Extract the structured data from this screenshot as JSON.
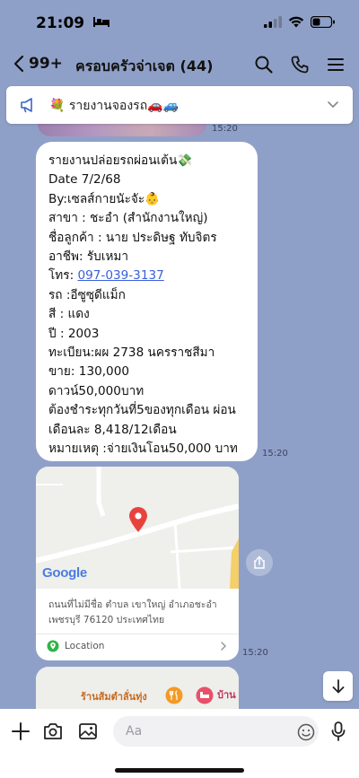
{
  "status_bar": {
    "time": "21:09"
  },
  "header": {
    "back_count": "99+",
    "title": "ครอบครัวจ่าเจต (44)"
  },
  "pinned": {
    "text": "💐 รายงานจองรถ🚗🚙"
  },
  "timestamps": {
    "photo": "15:20",
    "text_msg": "15:20",
    "location": "15:20"
  },
  "message": {
    "lines": [
      "รายงานปล่อยรถผ่อนเต้น💸",
      "Date 7/2/68",
      "By:เซลส์กายนัะจัะ👶",
      "สาขา : ชะอำ (สำนักงานใหญ่)",
      "ชื่อลูกค้า : นาย ประดิษฐ ทับจิตร",
      "อาชีพ: รับเหมา",
      "โทร: ",
      "รถ :อีซูซุดีแม็ก",
      "สี : แดง",
      "ปี : 2003",
      "ทะเบียน:ผผ 2738 นครราชสีมา",
      "ขาย: 130,000",
      "ดาวน์50,000บาท",
      "ต้องชำระทุกวันที่5ของทุกเดือน ผ่อน",
      "เดือนละ 8,418/12เดือน",
      "หมายเหตุ :จ่ายเงินโอน50,000 บาท"
    ],
    "phone": "097-039-3137"
  },
  "location": {
    "map_brand": "Google",
    "address": "ถนนที่ไม่มีชื่อ ตำบล เขาใหญ่ อำเภอชะอำ เพชรบุรี 76120 ประเทศไทย",
    "label": "Location"
  },
  "card2": {
    "place1": "ร้านส้มตำลั่นทุ่ง",
    "place2": "บ้าน"
  },
  "input": {
    "placeholder": "Aa"
  },
  "colors": {
    "background": "#8fa0c8",
    "link": "#3b5fd9",
    "pin": "#e8423f",
    "location_green": "#2fb44a"
  }
}
